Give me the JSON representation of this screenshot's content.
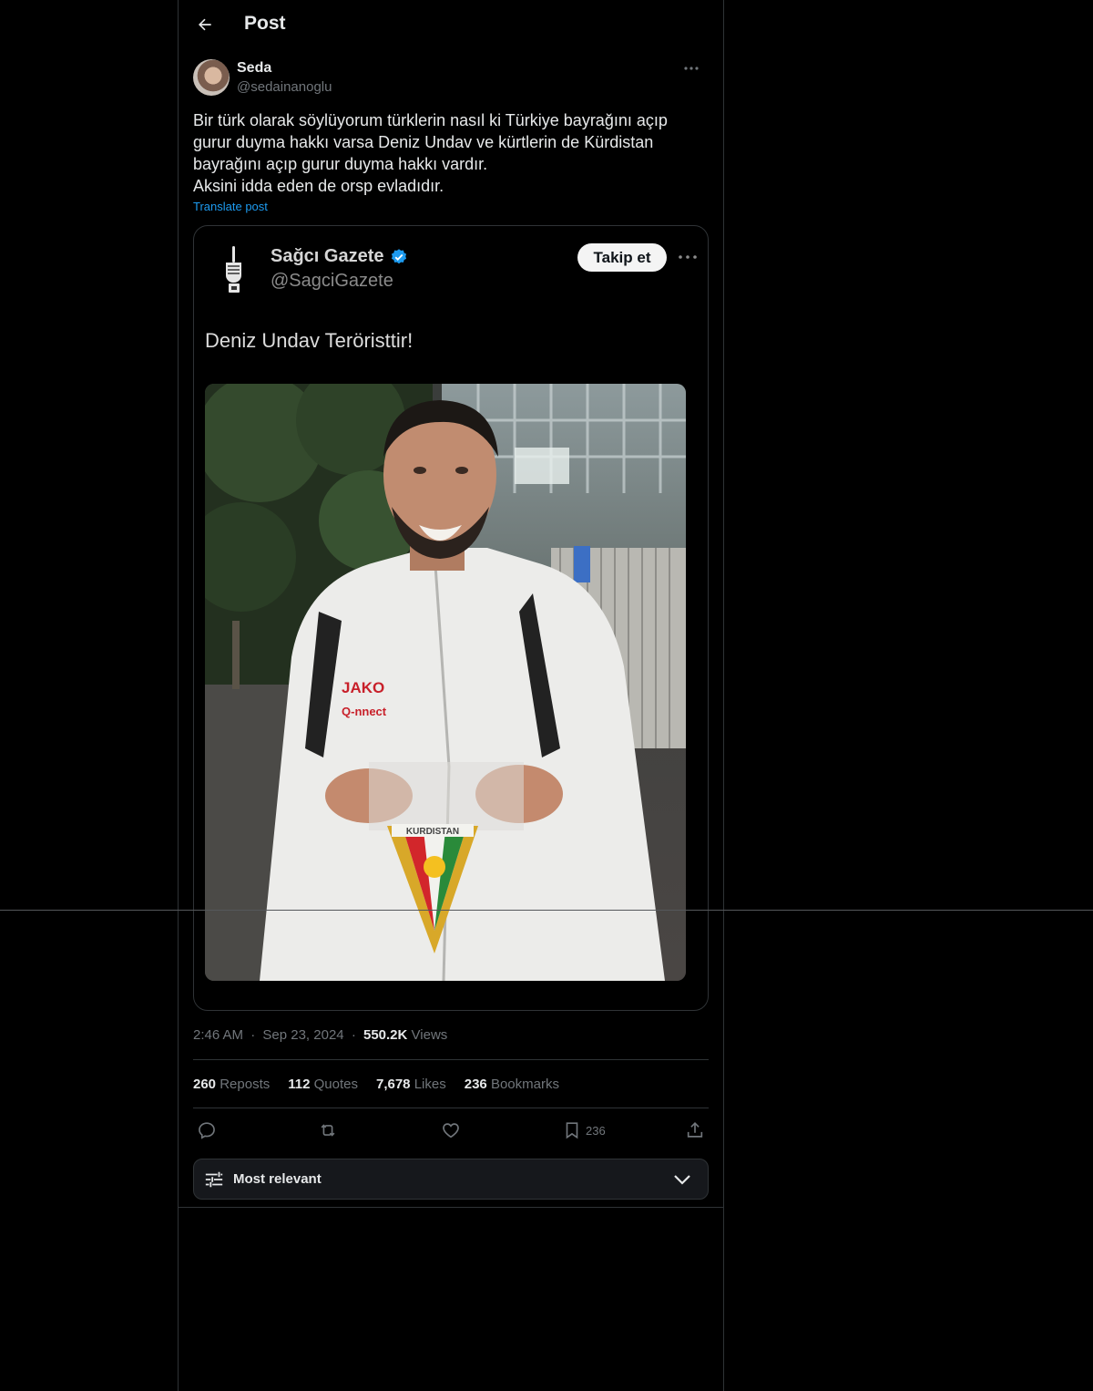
{
  "header": {
    "title": "Post"
  },
  "author": {
    "name": "Seda",
    "handle": "@sedainanoglu"
  },
  "post": {
    "lines": [
      "Bir türk olarak söylüyorum türklerin nasıl ki Türkiye bayrağını açıp",
      "gurur duyma hakkı varsa Deniz Undav ve kürtlerin de Kürdistan",
      "bayrağını açıp gurur duyma hakkı vardır.",
      "Aksini idda eden de orsp evladıdır."
    ],
    "translate_label": "Translate post"
  },
  "embedded": {
    "name": "Sağcı Gazete",
    "handle": "@SagciGazete",
    "follow_label": "Takip et",
    "text": "Deniz Undav Teröristtir!",
    "jacket_brand": "JAKO",
    "jacket_sponsor": "Q-nnect",
    "pennant_text": "KURDISTAN"
  },
  "meta": {
    "time": "2:46 AM",
    "dot": "·",
    "date": "Sep 23, 2024",
    "views_count": "550.2K",
    "views_label": "Views"
  },
  "stats": {
    "reposts_count": "260",
    "reposts_label": "Reposts",
    "quotes_count": "112",
    "quotes_label": "Quotes",
    "likes_count": "7,678",
    "likes_label": "Likes",
    "bookmarks_count": "236",
    "bookmarks_label": "Bookmarks"
  },
  "actions": {
    "bookmark_count": "236"
  },
  "sort": {
    "label": "Most relevant"
  },
  "icons": [
    "back-arrow-icon",
    "more-icon",
    "verified-icon",
    "reply-icon",
    "repost-icon",
    "like-icon",
    "bookmark-icon",
    "share-icon",
    "sliders-icon",
    "chevron-down-icon"
  ],
  "colors": {
    "background": "#000000",
    "text": "#e7e9ea",
    "muted": "#71767b",
    "link": "#1d9bf0",
    "border": "#2f3336"
  }
}
